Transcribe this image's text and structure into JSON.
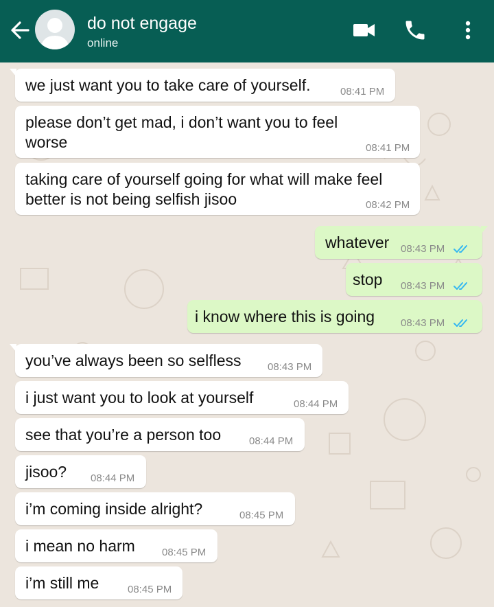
{
  "header": {
    "title": "do not engage",
    "status": "online"
  },
  "icons": {
    "back": "arrow-left-icon",
    "avatar": "default-avatar-icon",
    "video": "video-call-icon",
    "call": "phone-icon",
    "menu": "more-vertical-icon",
    "read": "double-check-icon"
  },
  "colors": {
    "header": "#075e54",
    "background": "#ece5dd",
    "incoming": "#ffffff",
    "outgoing": "#dcf8c6",
    "read_ticks": "#34b7f1"
  },
  "messages": [
    {
      "dir": "in",
      "text": "we just want you to take care of yourself.",
      "time": "08:41 PM"
    },
    {
      "dir": "in",
      "text": "please don’t get mad, i don’t want you to feel\nworse",
      "time": "08:41 PM"
    },
    {
      "dir": "in",
      "text": "taking care of yourself going for what will make feel\nbetter is not being selfish jisoo",
      "time": "08:42 PM"
    },
    {
      "dir": "out",
      "text": "whatever",
      "time": "08:43 PM",
      "status": "read"
    },
    {
      "dir": "out",
      "text": "stop",
      "time": "08:43 PM",
      "status": "read"
    },
    {
      "dir": "out",
      "text": "i know where this is going",
      "time": "08:43 PM",
      "status": "read"
    },
    {
      "dir": "in",
      "text": "you’ve always been so selfless",
      "time": "08:43 PM"
    },
    {
      "dir": "in",
      "text": "i just want you to look at yourself",
      "time": "08:44 PM"
    },
    {
      "dir": "in",
      "text": "see that you’re a person too",
      "time": "08:44 PM"
    },
    {
      "dir": "in",
      "text": "jisoo?",
      "time": "08:44 PM"
    },
    {
      "dir": "in",
      "text": "i’m coming inside alright?",
      "time": "08:45 PM"
    },
    {
      "dir": "in",
      "text": "i mean no harm",
      "time": "08:45 PM"
    },
    {
      "dir": "in",
      "text": "i’m still me",
      "time": "08:45 PM"
    }
  ]
}
